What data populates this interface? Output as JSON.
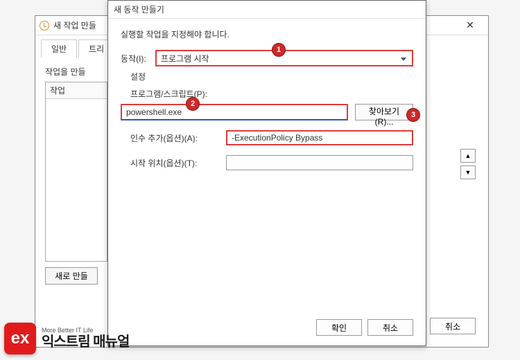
{
  "outer": {
    "title": "새 작업 만들",
    "tabs": {
      "general": "일반",
      "triggers": "트리"
    },
    "instruction": "작업을 만들",
    "list_header": "작업",
    "new_button": "새로 만들",
    "cancel": "취소"
  },
  "inner": {
    "title": "새 동작 만들기",
    "instruction": "실행할 작업을 지정해야 합니다.",
    "action_label": "동작(I):",
    "action_value": "프로그램 시작",
    "settings_label": "설정",
    "program_label": "프로그램/스크립트(P):",
    "program_value": "powershell.exe",
    "browse": "찾아보기(R)...",
    "args_label": "인수 추가(옵션)(A):",
    "args_value": "-ExecutionPolicy Bypass",
    "startin_label": "시작 위치(옵션)(T):",
    "startin_value": "",
    "ok": "확인",
    "cancel": "취소"
  },
  "badges": {
    "one": "1",
    "two": "2",
    "three": "3"
  },
  "logo": {
    "small": "More Better IT Life",
    "big": "익스트림 매뉴얼",
    "mark": "ex"
  }
}
